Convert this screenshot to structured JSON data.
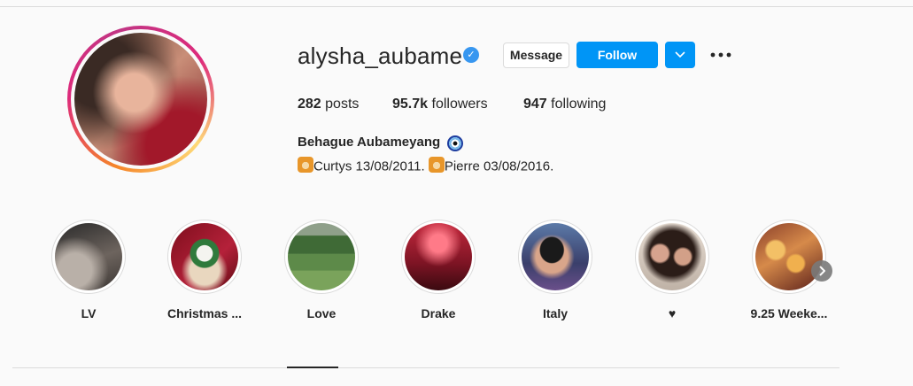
{
  "profile": {
    "username": "alysha_aubame",
    "verified_mark": "✓",
    "buttons": {
      "message": "Message",
      "follow": "Follow"
    },
    "stats": [
      {
        "count": "282",
        "label": "posts"
      },
      {
        "count": "95.7k",
        "label": "followers"
      },
      {
        "count": "947",
        "label": "following"
      }
    ],
    "full_name": "Behague Aubameyang",
    "bio": {
      "part1": "Curtys 13/08/2011.",
      "part2": "Pierre 03/08/2016."
    }
  },
  "highlights": [
    {
      "label": "LV",
      "icon": "lv-highlight"
    },
    {
      "label": "Christmas ...",
      "icon": "christmas-highlight"
    },
    {
      "label": "Love",
      "icon": "love-highlight"
    },
    {
      "label": "Drake",
      "icon": "drake-highlight"
    },
    {
      "label": "Italy",
      "icon": "italy-highlight"
    },
    {
      "label": "♥",
      "icon": "heart-highlight"
    },
    {
      "label": "9.25 Weeke...",
      "icon": "weekend-highlight"
    }
  ],
  "colors": {
    "follow_blue": "#0095f6",
    "verified_blue": "#3897f0",
    "text": "#262626",
    "border": "#dbdbdb"
  }
}
